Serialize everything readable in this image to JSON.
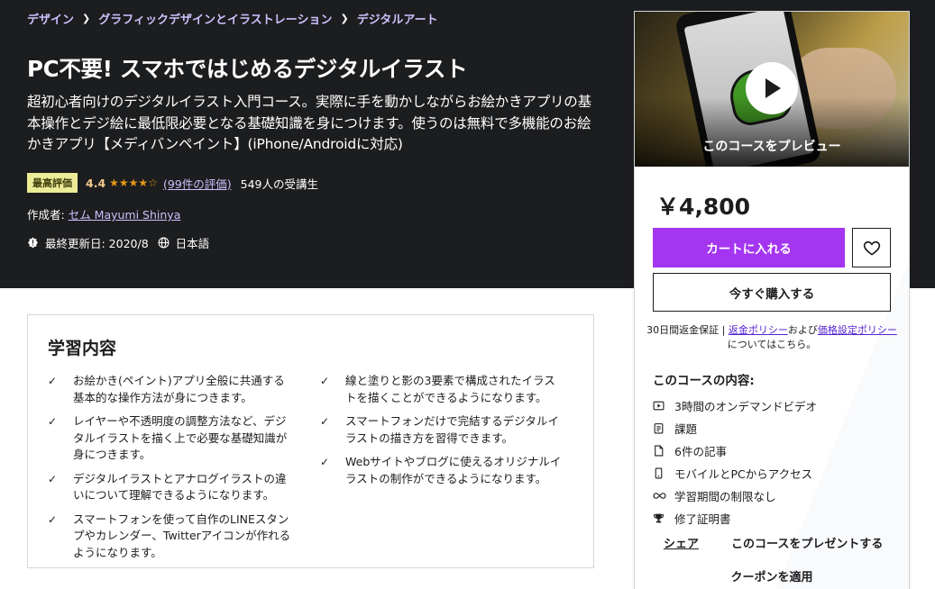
{
  "breadcrumb": [
    "デザイン",
    "グラフィックデザインとイラストレーション",
    "デジタルアート"
  ],
  "course": {
    "title": "PC不要! スマホではじめるデジタルイラスト",
    "description": "超初心者向けのデジタルイラスト入門コース。実際に手を動かしながらお絵かきアプリの基本操作とデジ絵に最低限必要となる基礎知識を身につけます。使うのは無料で多機能のお絵かきアプリ【メディバンペイント】(iPhone/Androidに対応)",
    "badge": "最高評価",
    "rating": "4.4",
    "stars": "★★★★☆",
    "rating_count": "(99件の評価)",
    "students": "549人の受講生",
    "author_prefix": "作成者: ",
    "author": "セム Mayumi Shinya",
    "last_updated": "最終更新日: 2020/8",
    "language": "日本語"
  },
  "learn": {
    "title": "学習内容",
    "check": "✓",
    "col1": [
      "お絵かき(ペイント)アプリ全般に共通する基本的な操作方法が身につきます。",
      "レイヤーや不透明度の調整方法など、デジタルイラストを描く上で必要な基礎知識が身につきます。",
      "デジタルイラストとアナログイラストの違いについて理解できるようになります。",
      "スマートフォンを使って自作のLINEスタンプやカレンダー、Twitterアイコンが作れるようになります。"
    ],
    "col2": [
      "線と塗りと影の3要素で構成されたイラストを描くことができるようになります。",
      "スマートフォンだけで完結するデジタルイラストの描き方を習得できます。",
      "Webサイトやブログに使えるオリジナルイラストの制作ができるようになります。"
    ]
  },
  "card": {
    "preview_label": "このコースをプレビュー",
    "price": "￥4,800",
    "cart_button": "カートに入れる",
    "buy_button": "今すぐ購入する",
    "guarantee_prefix": "30日間返金保証 | ",
    "refund_policy": "返金ポリシー",
    "and": "および",
    "pricing_policy": "価格設定ポリシー",
    "guarantee_suffix": "についてはこちら。",
    "includes_title": "このコースの内容:",
    "includes": [
      {
        "icon": "video-icon",
        "label": "3時間のオンデマンドビデオ"
      },
      {
        "icon": "assignment-icon",
        "label": "課題"
      },
      {
        "icon": "article-icon",
        "label": "6件の記事"
      },
      {
        "icon": "mobile-icon",
        "label": "モバイルとPCからアクセス"
      },
      {
        "icon": "infinity-icon",
        "label": "学習期間の制限なし"
      },
      {
        "icon": "trophy-icon",
        "label": "修了証明書"
      }
    ],
    "share": "シェア",
    "gift": "このコースをプレゼントする",
    "coupon": "クーポンを適用"
  },
  "colors": {
    "hero_bg": "#1c1d1f",
    "accent_purple": "#a435f0",
    "link_light": "#cec0fc",
    "star": "#e59819",
    "badge_bg": "#eceb98"
  }
}
